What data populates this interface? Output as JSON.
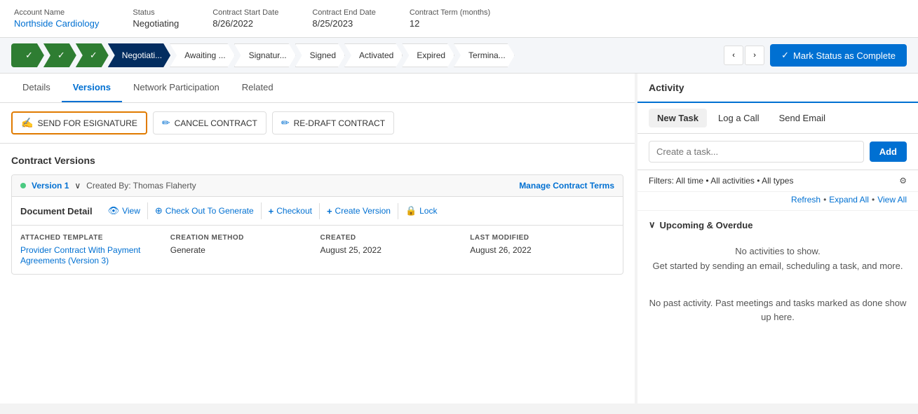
{
  "header": {
    "account_name_label": "Account Name",
    "account_name_value": "Northside Cardiology",
    "status_label": "Status",
    "status_value": "Negotiating",
    "start_date_label": "Contract Start Date",
    "start_date_value": "8/26/2022",
    "end_date_label": "Contract End Date",
    "end_date_value": "8/25/2023",
    "term_label": "Contract Term (months)",
    "term_value": "12"
  },
  "status_bar": {
    "steps": [
      {
        "label": "✓",
        "state": "completed_icon"
      },
      {
        "label": "✓",
        "state": "completed_icon"
      },
      {
        "label": "✓",
        "state": "completed_icon"
      },
      {
        "label": "Negotiati...",
        "state": "active"
      },
      {
        "label": "Awaiting ...",
        "state": "inactive"
      },
      {
        "label": "Signatur...",
        "state": "inactive"
      },
      {
        "label": "Signed",
        "state": "inactive"
      },
      {
        "label": "Activated",
        "state": "inactive"
      },
      {
        "label": "Expired",
        "state": "inactive"
      },
      {
        "label": "Termina...",
        "state": "inactive"
      }
    ],
    "mark_complete_label": "Mark Status as Complete"
  },
  "tabs": {
    "items": [
      {
        "label": "Details",
        "active": false
      },
      {
        "label": "Versions",
        "active": true
      },
      {
        "label": "Network Participation",
        "active": false
      },
      {
        "label": "Related",
        "active": false
      }
    ]
  },
  "action_buttons": [
    {
      "label": "SEND FOR ESIGNATURE",
      "highlighted": true,
      "icon": "✍"
    },
    {
      "label": "CANCEL CONTRACT",
      "highlighted": false,
      "icon": "✏"
    },
    {
      "label": "RE-DRAFT CONTRACT",
      "highlighted": false,
      "icon": "✏"
    }
  ],
  "contract_versions": {
    "title": "Contract Versions",
    "version": {
      "label": "Version 1",
      "chevron": "∨",
      "created_by": "Created By: Thomas Flaherty",
      "manage_link": "Manage Contract Terms",
      "doc_title": "Document Detail",
      "doc_actions": [
        {
          "label": "View",
          "icon": "👁"
        },
        {
          "label": "Check Out To Generate",
          "icon": "⊕"
        },
        {
          "label": "Checkout",
          "icon": "+"
        },
        {
          "label": "Create Version",
          "icon": "+"
        },
        {
          "label": "Lock",
          "icon": "🔒"
        }
      ],
      "details": {
        "attached_template_label": "ATTACHED TEMPLATE",
        "attached_template_value": "Provider Contract With Payment Agreements (Version 3)",
        "creation_method_label": "CREATION METHOD",
        "creation_method_value": "Generate",
        "created_label": "CREATED",
        "created_value": "August 25, 2022",
        "last_modified_label": "LAST MODIFIED",
        "last_modified_value": "August 26, 2022"
      }
    }
  },
  "activity": {
    "title": "Activity",
    "tabs": [
      {
        "label": "New Task",
        "active": true
      },
      {
        "label": "Log a Call",
        "active": false
      },
      {
        "label": "Send Email",
        "active": false
      }
    ],
    "task_placeholder": "Create a task...",
    "add_button_label": "Add",
    "filters_text": "Filters: All time • All activities • All types",
    "refresh_link": "Refresh",
    "expand_all_link": "Expand All",
    "view_all_link": "View All",
    "upcoming_title": "Upcoming & Overdue",
    "no_activities_text": "No activities to show.",
    "no_activities_sub": "Get started by sending an email, scheduling a task, and more.",
    "past_activity_text": "No past activity. Past meetings and tasks marked as done show up here."
  }
}
